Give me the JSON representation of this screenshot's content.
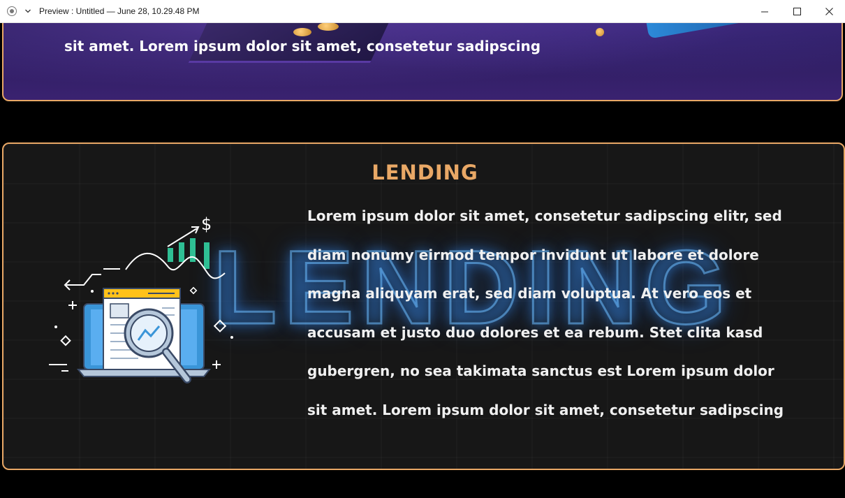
{
  "window": {
    "title": "Preview : Untitled — June 28, 10.29.48 PM"
  },
  "top_section": {
    "text": "sit amet. Lorem ipsum dolor sit amet, consetetur sadipscing"
  },
  "lending": {
    "title": "LENDING",
    "background_word": "LENDING",
    "body_lines": [
      "Lorem ipsum dolor sit amet, consetetur sadipscing elitr, sed",
      "diam nonumy eirmod tempor invidunt ut labore et dolore",
      "magna aliquyam erat, sed diam voluptua. At vero eos et",
      "accusam et justo duo dolores et ea rebum. Stet clita kasd",
      "gubergren, no sea takimata sanctus est Lorem ipsum dolor",
      "sit amet. Lorem ipsum dolor sit amet, consetetur sadipscing"
    ],
    "illustration_icon": "laptop-magnifier-analytics-icon"
  },
  "colors": {
    "accent": "#e9a866",
    "card_border": "#e9a866",
    "neon_blue": "#6ebeff",
    "top_card_bg": "#2b1d5e",
    "lending_card_bg": "#171717"
  }
}
